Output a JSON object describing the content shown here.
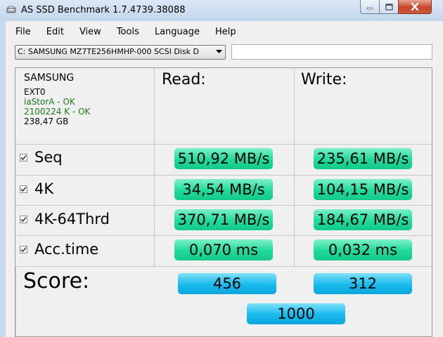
{
  "window": {
    "title": "AS SSD Benchmark 1.7.4739.38088"
  },
  "menu": [
    "File",
    "Edit",
    "View",
    "Tools",
    "Language",
    "Help"
  ],
  "drive_select": {
    "value": "C: SAMSUNG MZ7TE256HMHP-000 SCSI Disk D"
  },
  "drive_info": {
    "vendor": "SAMSUNG",
    "firmware": "EXT0",
    "driver": "iaStorA - OK",
    "alignment": "2100224 K - OK",
    "capacity": "238,47 GB"
  },
  "columns": {
    "read": "Read:",
    "write": "Write:"
  },
  "rows": [
    {
      "label": "Seq",
      "checked": true,
      "read": "510,92 MB/s",
      "write": "235,61 MB/s"
    },
    {
      "label": "4K",
      "checked": true,
      "read": "34,54 MB/s",
      "write": "104,15 MB/s"
    },
    {
      "label": "4K-64Thrd",
      "checked": true,
      "read": "370,71 MB/s",
      "write": "184,67 MB/s"
    },
    {
      "label": "Acc.time",
      "checked": true,
      "read": "0,070 ms",
      "write": "0,032 ms"
    }
  ],
  "score": {
    "label": "Score:",
    "read": "456",
    "write": "312",
    "total": "1000"
  },
  "colors": {
    "result_green": "#1fd99a",
    "score_blue": "#18b9ec",
    "ok_green": "#1e7a1e"
  }
}
